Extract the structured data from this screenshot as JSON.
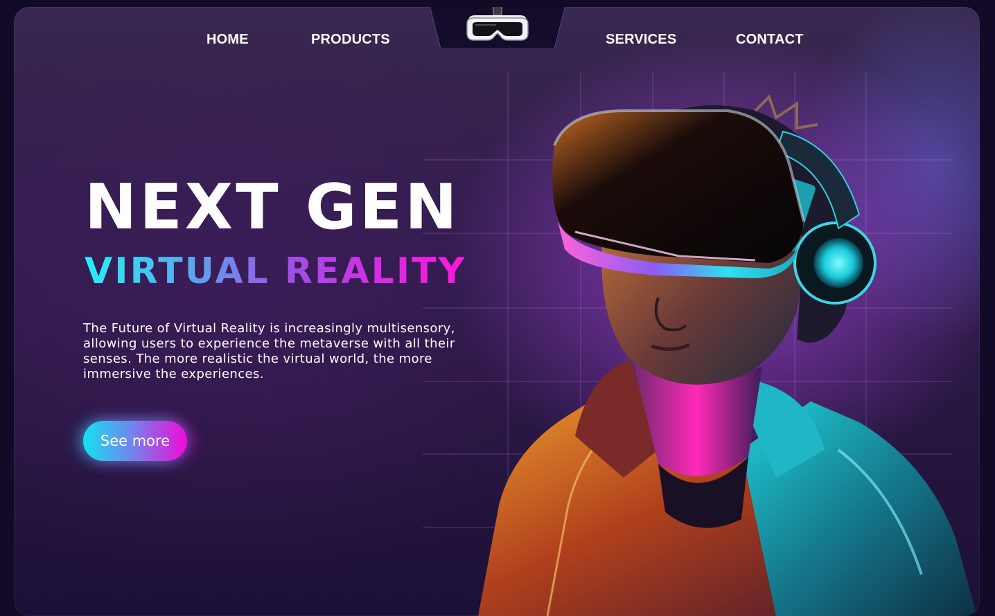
{
  "nav": {
    "items": [
      {
        "label": "HOME"
      },
      {
        "label": "PRODUCTS"
      },
      {
        "label": "SERVICES"
      },
      {
        "label": "CONTACT"
      }
    ],
    "logo_icon": "vr-headset-icon"
  },
  "hero": {
    "title": "NEXT GEN",
    "subtitle": "VIRTUAL REALITY",
    "description": "The Future of Virtual Reality is increasingly multisensory, allowing users to experience the metaverse with all their senses. The more realistic the virtual world, the more immersive the experiences.",
    "cta_label": "See more",
    "image_subject": "person-wearing-vr-headset"
  },
  "colors": {
    "background": "#2e1c48",
    "accent_cyan": "#19e3f0",
    "accent_magenta": "#f00bd6",
    "purple_glow": "#a845e0"
  }
}
